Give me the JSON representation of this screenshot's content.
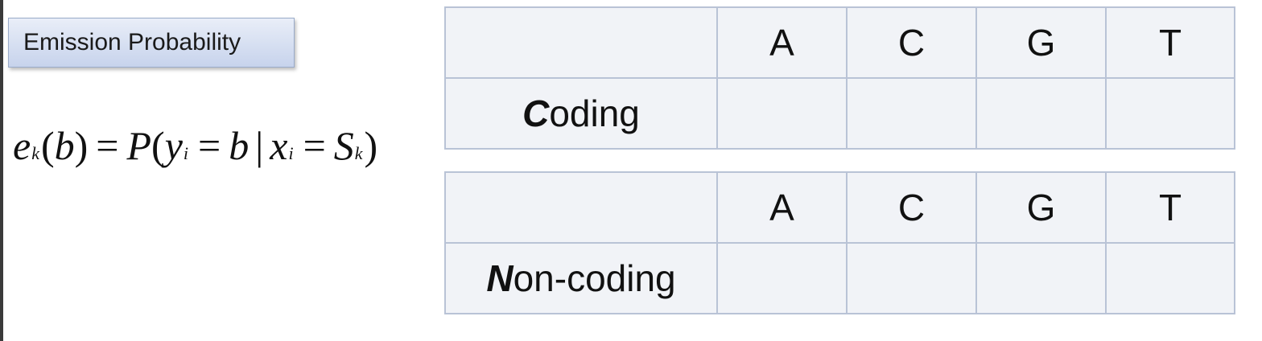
{
  "label": "Emission Probability",
  "formula": {
    "e": "e",
    "k": "k",
    "b": "b",
    "P": "P",
    "y": "y",
    "i": "i",
    "x": "x",
    "S": "S"
  },
  "tables": [
    {
      "headers": [
        "A",
        "C",
        "G",
        "T"
      ],
      "row_label_lead": "C",
      "row_label_rest": "oding",
      "cells": [
        "",
        "",
        "",
        ""
      ]
    },
    {
      "headers": [
        "A",
        "C",
        "G",
        "T"
      ],
      "row_label_lead": "N",
      "row_label_rest": "on-coding",
      "cells": [
        "",
        "",
        "",
        ""
      ]
    }
  ]
}
